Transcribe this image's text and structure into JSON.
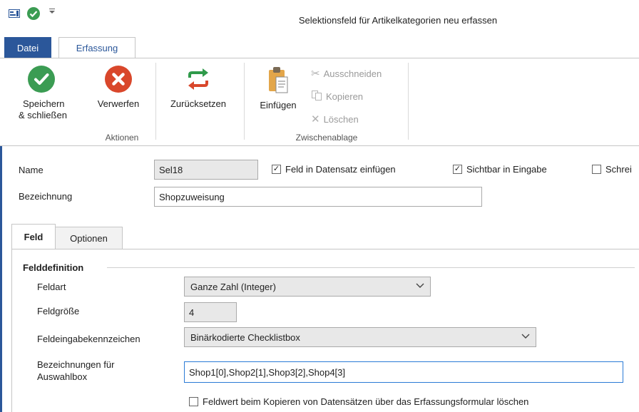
{
  "window": {
    "title": "Selektionsfeld für Artikelkategorien neu erfassen"
  },
  "ribbon_tabs": {
    "datei": "Datei",
    "erfassung": "Erfassung"
  },
  "ribbon": {
    "speichern": "Speichern\n& schließen",
    "speichern_l1": "Speichern",
    "speichern_l2": "& schließen",
    "verwerfen": "Verwerfen",
    "zuruecksetzen": "Zurücksetzen",
    "einfuegen": "Einfügen",
    "ausschneiden": "Ausschneiden",
    "kopieren": "Kopieren",
    "loeschen": "Löschen",
    "group_aktionen": "Aktionen",
    "group_zwischenablage": "Zwischenablage"
  },
  "form": {
    "name_label": "Name",
    "name_value": "Sel18",
    "bezeichnung_label": "Bezeichnung",
    "bezeichnung_value": "Shopzuweisung",
    "chk_feld_in_datensatz": "Feld in Datensatz einfügen",
    "chk_sichtbar": "Sichtbar in Eingabe",
    "chk_schreib": "Schrei"
  },
  "tabs": {
    "feld": "Feld",
    "optionen": "Optionen"
  },
  "felddef": {
    "section_title": "Felddefinition",
    "feldart_label": "Feldart",
    "feldart_value": "Ganze Zahl (Integer)",
    "feldgroesse_label": "Feldgröße",
    "feldgroesse_value": "4",
    "feldeingabe_label": "Feldeingabekennzeichen",
    "feldeingabe_value": "Binärkodierte Checklistbox",
    "bez_auswahl_label1": "Bezeichnungen für",
    "bez_auswahl_label2": "Auswahlbox",
    "bez_auswahl_value": "Shop1[0],Shop2[1],Shop3[2],Shop4[3]",
    "chk_feldwert": "Feldwert beim Kopieren von Datensätzen über das Erfassungsformular löschen"
  },
  "colors": {
    "accent": "#2b579a",
    "ok_green": "#3b9c53",
    "cancel_red": "#d9472b",
    "reset_green": "#2f9a4a",
    "reset_red": "#d9472b"
  }
}
